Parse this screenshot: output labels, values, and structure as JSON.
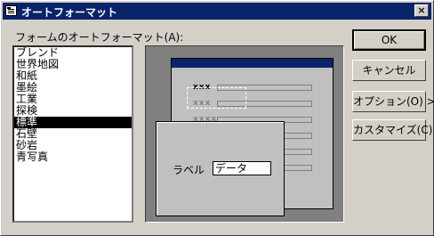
{
  "window": {
    "title": "オートフォーマット",
    "close_label": "×"
  },
  "list": {
    "label": "フォームのオートフォーマット(A):",
    "items": [
      "ブレンド",
      "世界地図",
      "和紙",
      "墨絵",
      "工業",
      "探検",
      "標準",
      "石壁",
      "砂岩",
      "青写真"
    ],
    "selected_index": 6
  },
  "preview": {
    "rows": [
      "xxx",
      "xxx",
      "xxxx"
    ],
    "zoom_label": "ラベル",
    "zoom_value": "データ"
  },
  "buttons": {
    "ok": "OK",
    "cancel": "キャンセル",
    "options": "オプション(O) >>",
    "customize": "カスタマイズ(C)..."
  }
}
